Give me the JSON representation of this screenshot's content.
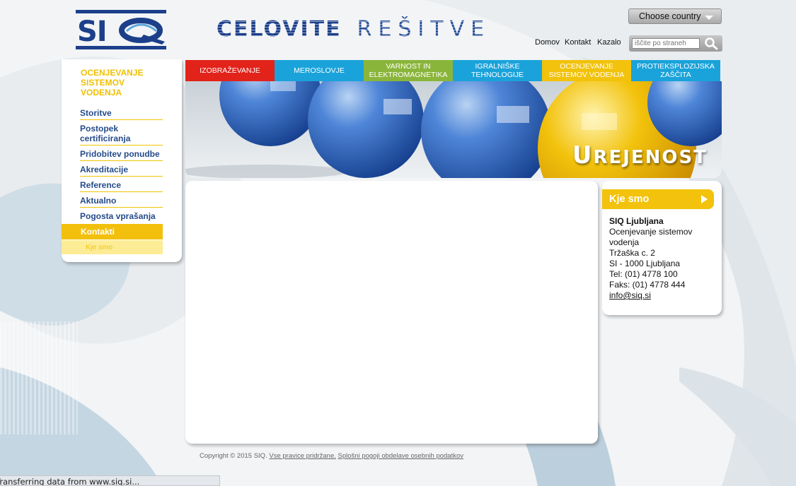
{
  "header": {
    "logo_text": "SIQ",
    "tagline_bold": "CELOVITE",
    "tagline_light": "REŠITVE",
    "country_button": "Choose country",
    "links": [
      "Domov",
      "Kontakt",
      "Kazalo"
    ],
    "search_placeholder": "iščite po straneh"
  },
  "topmenu": [
    {
      "label": "IZOBRAŽEVANJE",
      "color": "#e2231a"
    },
    {
      "label": "MEROSLOVJE",
      "color": "#1aa3da"
    },
    {
      "label": "VARNOST IN ELEKTROMAGNETIKA",
      "color": "#8ab53b"
    },
    {
      "label": "IGRALNIŠKE TEHNOLOGIJE",
      "color": "#1aa3da"
    },
    {
      "label": "OCENJEVANJE SISTEMOV VODENJA",
      "color": "#f2c20c"
    },
    {
      "label": "PROTIEKSPLOZIJSKA ZAŠČITA",
      "color": "#1aa3da"
    }
  ],
  "banner": {
    "word_cap": "U",
    "word_rest": "REJENOST"
  },
  "leftnav": {
    "heading": "OCENJEVANJE SISTEMOV VODENJA",
    "items": [
      "Storitve",
      "Postopek certificiranja",
      "Pridobitev ponudbe",
      "Akreditacije",
      "Reference",
      "Aktualno",
      "Pogosta vprašanja"
    ],
    "active": "Kontakti",
    "subitem": "Kje smo"
  },
  "contact": {
    "title": "Kje smo",
    "org": "SIQ Ljubljana",
    "dept": "Ocenjevanje sistemov vodenja",
    "street": "Tržaška c. 2",
    "city": "SI - 1000 Ljubljana",
    "tel": "Tel: (01) 4778 100",
    "fax": "Faks: (01) 4778 444",
    "email": "info@siq.si"
  },
  "footer": {
    "copyright": "Copyright © 2015 SIQ.",
    "rights": "Vse pravice pridržane.",
    "terms": "Splošni pogoji obdelave osebnih podatkov"
  },
  "statusbar": "Transferring data from www.siq.si...",
  "colors": {
    "brand_blue": "#1c3f8a",
    "accent_yellow": "#f2c20c",
    "nav_text": "#254b8a"
  }
}
